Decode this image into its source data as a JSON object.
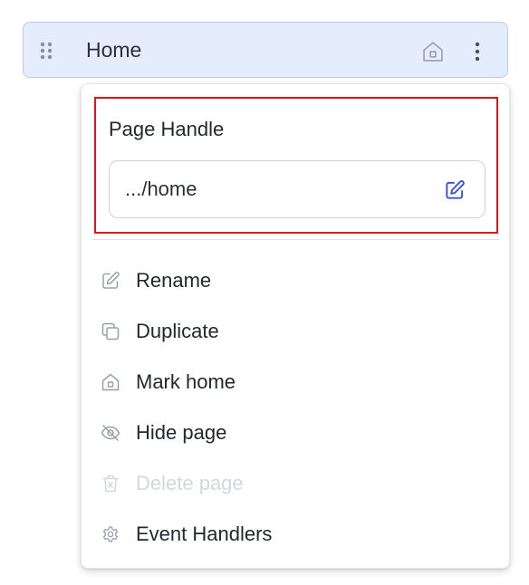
{
  "page": {
    "name": "Home"
  },
  "menu": {
    "handle": {
      "title": "Page Handle",
      "value": ".../home"
    },
    "items": [
      {
        "label": "Rename",
        "icon": "pencil-icon",
        "disabled": false
      },
      {
        "label": "Duplicate",
        "icon": "copy-icon",
        "disabled": false
      },
      {
        "label": "Mark home",
        "icon": "home-icon",
        "disabled": false
      },
      {
        "label": "Hide page",
        "icon": "eye-off-icon",
        "disabled": false
      },
      {
        "label": "Delete page",
        "icon": "trash-icon",
        "disabled": true
      },
      {
        "label": "Event Handlers",
        "icon": "gear-icon",
        "disabled": false
      }
    ]
  },
  "colors": {
    "row_background": "#e5ecfb",
    "row_border": "#bccaf0",
    "accent": "#3a56d6",
    "highlight_border": "#e0141b",
    "disabled_text": "#d4d7dc"
  }
}
